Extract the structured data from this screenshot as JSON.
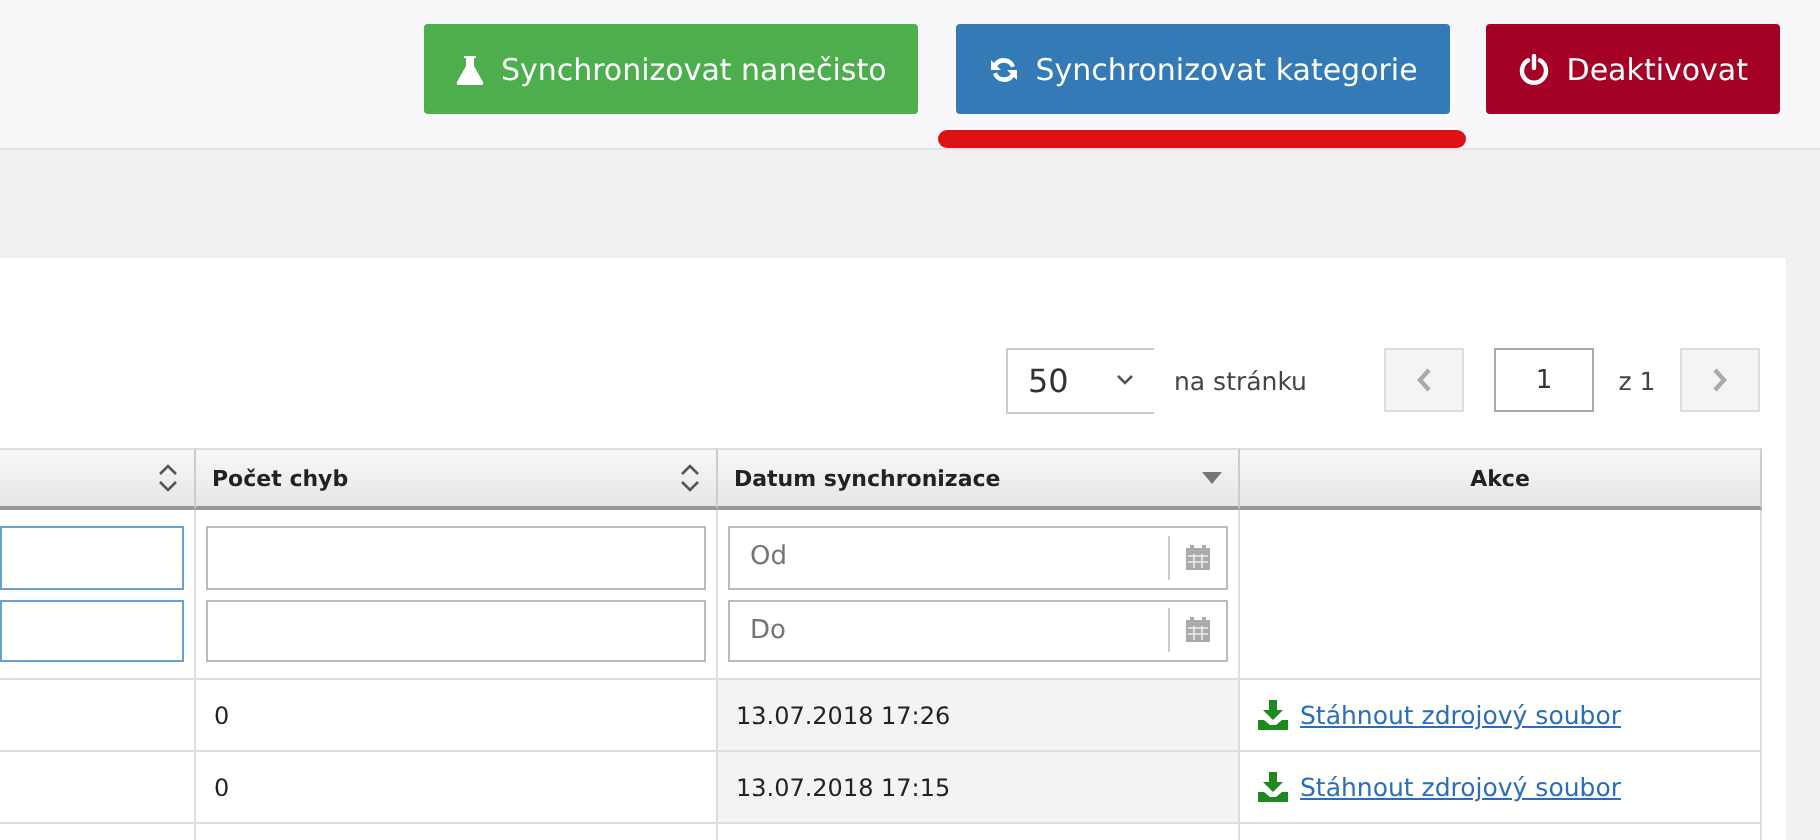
{
  "toolbar": {
    "buttons": [
      {
        "kind": "flask",
        "label": "Synchronizovat nanečisto",
        "color": "#4cae4c",
        "highlighted": false
      },
      {
        "kind": "sync",
        "label": "Synchronizovat kategorie",
        "color": "#337ab7",
        "highlighted": true
      },
      {
        "kind": "power",
        "label": "Deaktivovat",
        "color": "#a50026",
        "highlighted": false
      }
    ]
  },
  "pagination": {
    "page_size": "50",
    "page_size_label": "na stránku",
    "prev_disabled": true,
    "page": "1",
    "of_pages": "z 1",
    "next_disabled": true
  },
  "table": {
    "columns": [
      {
        "kind": "data",
        "sortable": true,
        "sorted": false
      },
      {
        "kind": "data",
        "label": "Počet chyb",
        "sortable": true,
        "sorted": false
      },
      {
        "kind": "data",
        "label": "Datum synchronizace",
        "sortable": true,
        "sorted": true
      },
      {
        "kind": "action",
        "label": "Akce",
        "sortable": false
      }
    ],
    "filters": [
      {
        "kind": "text",
        "focused": true
      },
      {
        "kind": "text",
        "focused": false
      },
      {
        "kind": "date",
        "from_placeholder": "Od",
        "to_placeholder": "Do"
      },
      {
        "kind": "none"
      }
    ],
    "rows": [
      {
        "cells": [
          "",
          "0",
          "13.07.2018 17:26"
        ],
        "action": "Stáhnout zdrojový soubor"
      },
      {
        "cells": [
          "",
          "0",
          "13.07.2018 17:15"
        ],
        "action": "Stáhnout zdrojový soubor"
      }
    ]
  }
}
